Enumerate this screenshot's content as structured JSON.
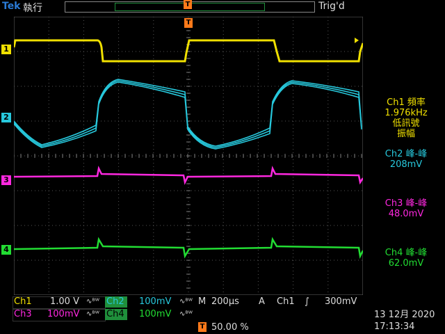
{
  "header": {
    "brand": "Tek",
    "mode": "執行",
    "trigger_status": "Trig'd"
  },
  "markers": {
    "trigger_pos": "T",
    "trigger_level": "T"
  },
  "channels": [
    {
      "id": "1",
      "color": "#f0e000"
    },
    {
      "id": "2",
      "color": "#27c8dc"
    },
    {
      "id": "3",
      "color": "#ff28e0"
    },
    {
      "id": "4",
      "color": "#22dd33"
    }
  ],
  "measurements": {
    "ch1_label": "Ch1 頻率",
    "ch1_value": "1.976kHz",
    "ch1_note1": "低訊號",
    "ch1_note2": "振幅",
    "ch2_label": "Ch2 峰-峰",
    "ch2_value": "208mV",
    "ch3_label": "Ch3 峰-峰",
    "ch3_value": "48.0mV",
    "ch4_label": "Ch4 峰-峰",
    "ch4_value": "62.0mV"
  },
  "settings": {
    "ch1": "Ch1",
    "ch1_scale": "1.00 V",
    "ch2": "Ch2",
    "ch2_scale": "100mV",
    "ch3": "Ch3",
    "ch3_scale": "100mV",
    "ch4": "Ch4",
    "ch4_scale": "100mV",
    "timebase_label": "M",
    "timebase": "200µs",
    "trigger_mode": "A",
    "trigger_source": "Ch1",
    "trigger_slope": "∫",
    "trigger_level": "300mV",
    "bw_tag": "∿ᴮᵂ",
    "trigger_position": "50.00 %"
  },
  "datetime": {
    "date": "13 12月 2020",
    "time": "17:13:34"
  }
}
